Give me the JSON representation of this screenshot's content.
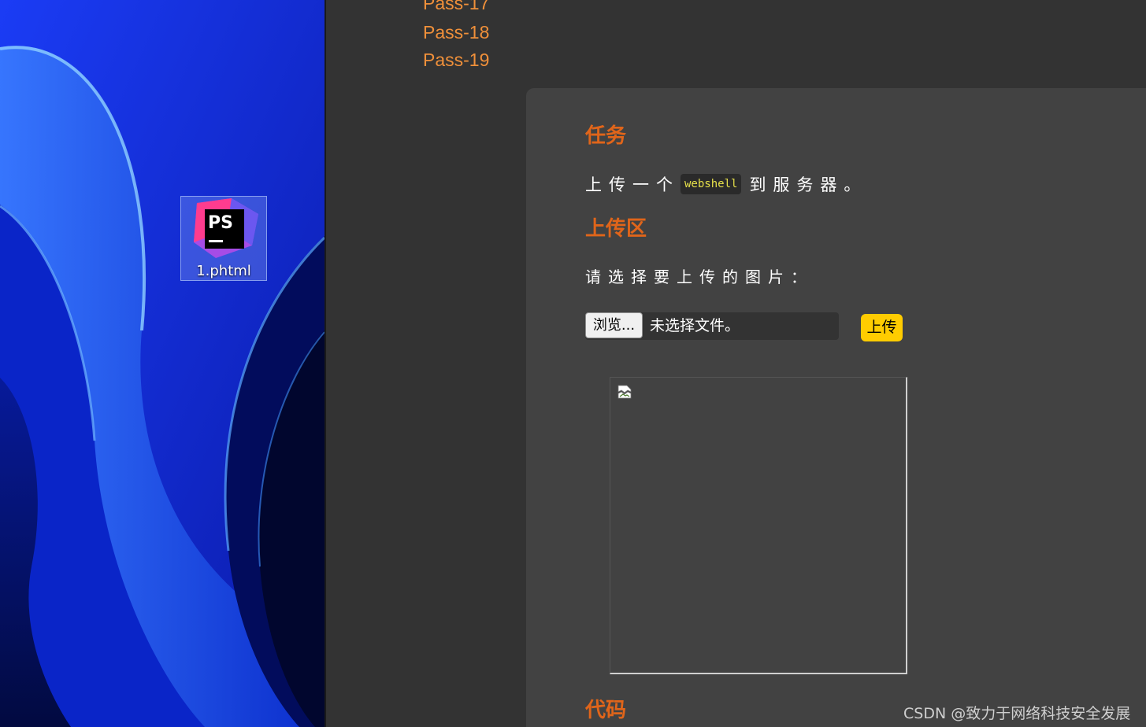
{
  "desktop": {
    "file_icon": {
      "label": "1.phtml",
      "logo_text": "PS"
    }
  },
  "nav": {
    "items": [
      "Pass-17",
      "Pass-18",
      "Pass-19"
    ]
  },
  "content": {
    "task_heading": "任务",
    "task_text_before": "上传一个",
    "task_code": "webshell",
    "task_text_after": "到服务器。",
    "upload_heading": "上传区",
    "upload_prompt": "请选择要上传的图片：",
    "browse_label": "浏览...",
    "file_status": "未选择文件。",
    "upload_button": "上传",
    "code_heading": "代码"
  },
  "watermark": "CSDN @致力于网络科技安全发展",
  "colors": {
    "heading": "#e0651a",
    "nav_link": "#f0903a",
    "upload_button": "#ffcc00",
    "code_text": "#e6e04a",
    "panel": "#424242",
    "page": "#333333"
  }
}
